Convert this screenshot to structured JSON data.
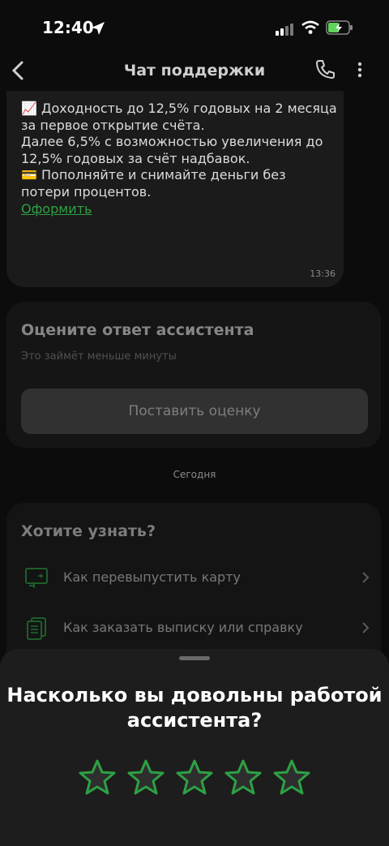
{
  "status_bar": {
    "time": "12:40"
  },
  "header": {
    "title": "Чат поддержки"
  },
  "message": {
    "text": "📈 Доходность до 12,5% годовых на 2 месяца за первое открытие счёта.\nДалее 6,5% с возможностью увеличения до 12,5% годовых за счёт надбавок.\n💳 Пополняйте и снимайте деньги без потери процентов.",
    "link": "Оформить",
    "time": "13:36"
  },
  "rating_card": {
    "title": "Оцените ответ ассистента",
    "subtitle": "Это займёт меньше минуты",
    "button": "Поставить оценку"
  },
  "date_separator": "Сегодня",
  "faq": {
    "title": "Хотите узнать?",
    "items": [
      {
        "label": "Как перевыпустить карту",
        "icon": "card-reissue-icon"
      },
      {
        "label": "Как заказать выписку или справку",
        "icon": "documents-icon"
      }
    ]
  },
  "sheet": {
    "title": "Насколько вы довольны работой\nассистента?",
    "stars": 5
  },
  "colors": {
    "accent": "#2da144",
    "star_fill": "#2e2e2e"
  }
}
